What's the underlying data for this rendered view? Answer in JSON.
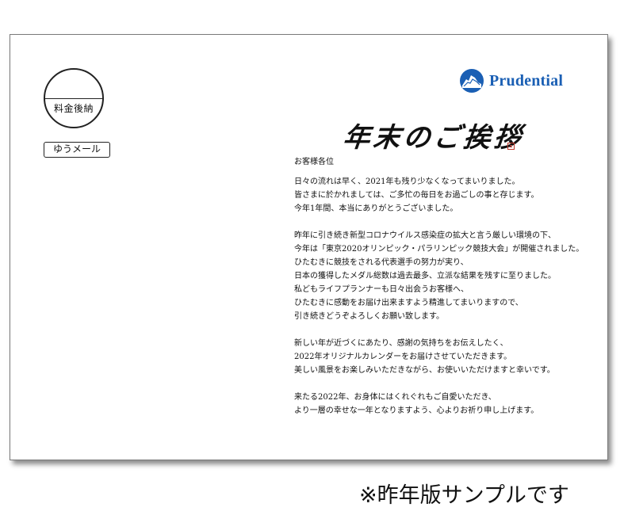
{
  "postage": {
    "stamp_text": "料金後納",
    "mail_type": "ゆうメール"
  },
  "logo": {
    "name": "Prudential",
    "icon": "rock-of-gibraltar-icon",
    "color": "#1a5fb4"
  },
  "letter": {
    "title": "年末のご挨拶",
    "salutation": "お客様各位",
    "paragraphs": [
      {
        "lines": [
          "日々の流れは早く、2021年も残り少なくなってまいりました。",
          "皆さまに於かれましては、ご多忙の毎日をお過ごしの事と存じます。",
          "今年1年間、本当にありがとうございました。"
        ]
      },
      {
        "lines": [
          "昨年に引き続き新型コロナウイルス感染症の拡大と言う厳しい環境の下、",
          "今年は「東京2020オリンピック・パラリンピック競技大会」が開催されました。",
          "ひたむきに競技をされる代表選手の努力が実り、",
          "日本の獲得したメダル総数は過去最多、立派な結果を残すに至りました。",
          "私どもライフプランナーも日々出会うお客様へ、",
          "ひたむきに感動をお届け出来ますよう精進してまいりますので、",
          "引き続きどうぞよろしくお願い致します。"
        ]
      },
      {
        "lines": [
          "新しい年が近づくにあたり、感謝の気持ちをお伝えしたく、",
          "2022年オリジナルカレンダーをお届けさせていただきます。",
          "美しい風景をお楽しみいただきながら、お使いいただけますと幸いです。"
        ]
      },
      {
        "lines": [
          "来たる2022年、お身体にはくれぐれもご自愛いただき、",
          "より一層の幸せな一年となりますよう、心よりお祈り申し上げます。"
        ]
      }
    ]
  },
  "caption": "※昨年版サンプルです"
}
